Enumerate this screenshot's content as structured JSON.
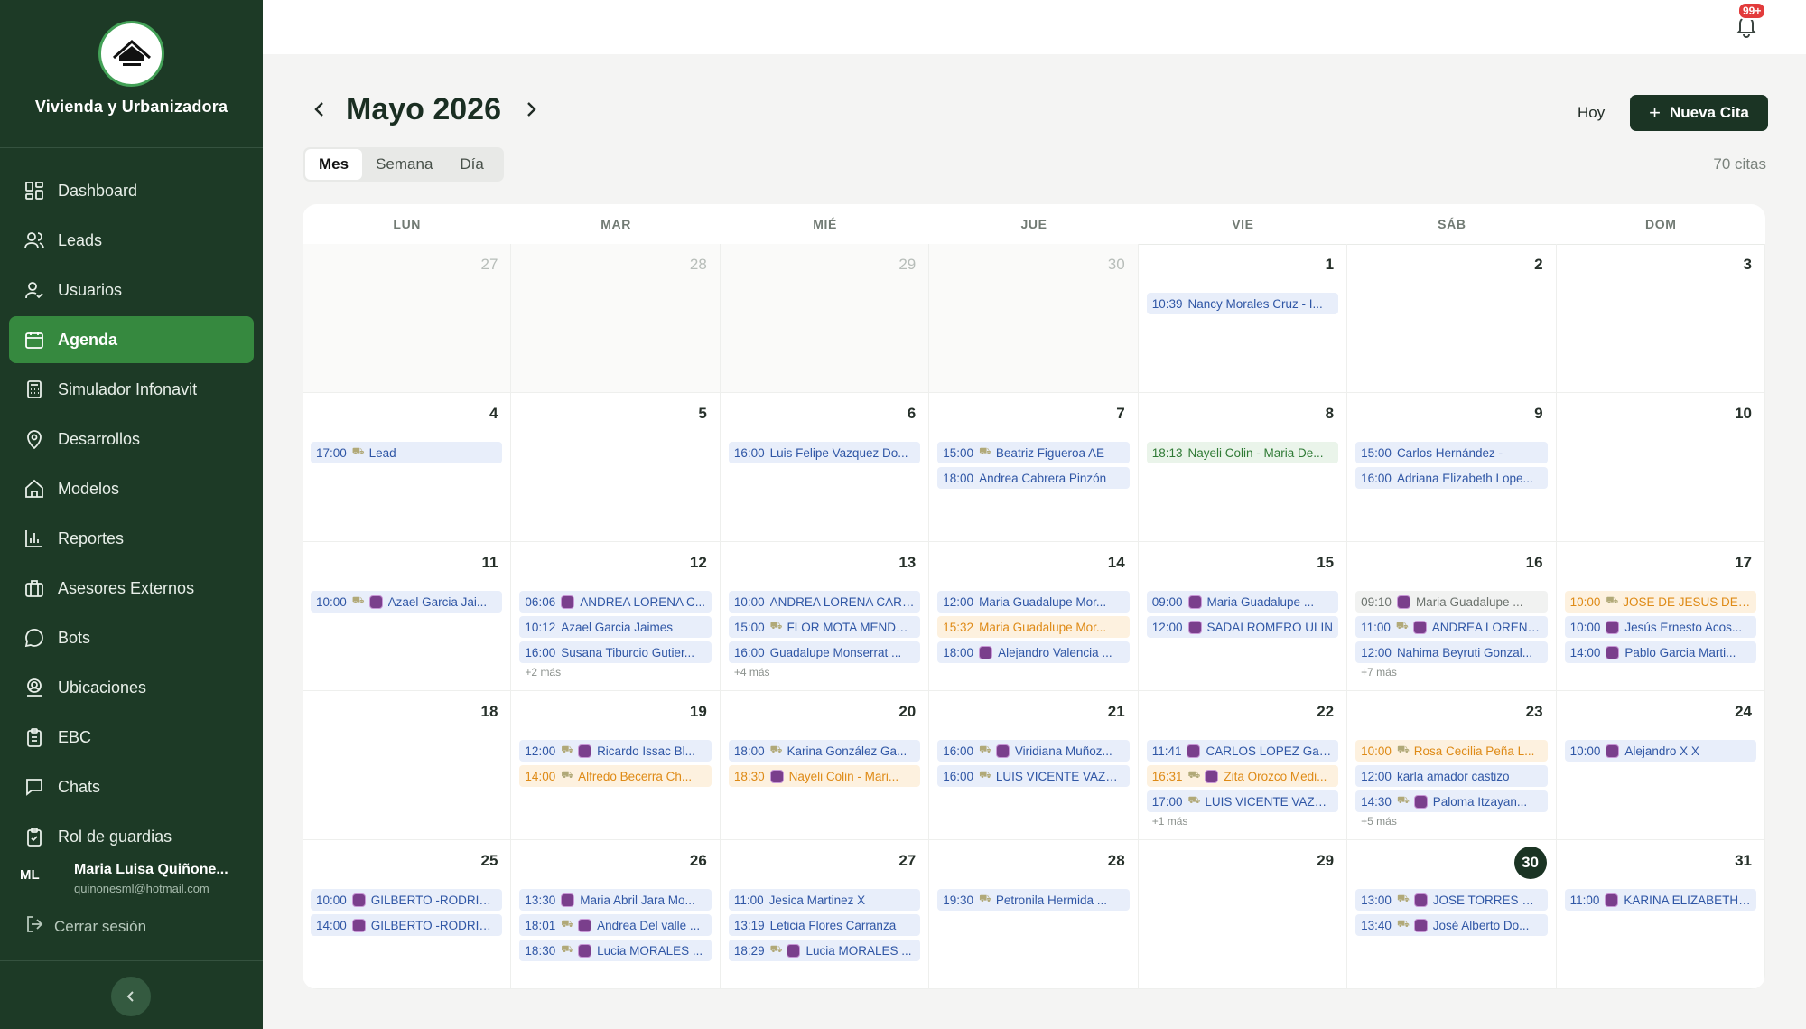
{
  "brand": {
    "name": "Vivienda y Urbanizadora"
  },
  "nav": [
    {
      "label": "Dashboard",
      "icon": "dashboard-icon",
      "active": false
    },
    {
      "label": "Leads",
      "icon": "users-icon",
      "active": false
    },
    {
      "label": "Usuarios",
      "icon": "user-check-icon",
      "active": false
    },
    {
      "label": "Agenda",
      "icon": "calendar-icon",
      "active": true
    },
    {
      "label": "Simulador Infonavit",
      "icon": "calculator-icon",
      "active": false
    },
    {
      "label": "Desarrollos",
      "icon": "map-pin-icon",
      "active": false
    },
    {
      "label": "Modelos",
      "icon": "home-icon",
      "active": false
    },
    {
      "label": "Reportes",
      "icon": "bar-chart-icon",
      "active": false
    },
    {
      "label": "Asesores Externos",
      "icon": "briefcase-icon",
      "active": false
    },
    {
      "label": "Bots",
      "icon": "chat-bubble-icon",
      "active": false
    },
    {
      "label": "Ubicaciones",
      "icon": "user-location-icon",
      "active": false
    },
    {
      "label": "EBC",
      "icon": "clipboard-icon",
      "active": false
    },
    {
      "label": "Chats",
      "icon": "message-square-icon",
      "active": false
    },
    {
      "label": "Rol de guardias",
      "icon": "clipboard-check-icon",
      "active": false
    }
  ],
  "user": {
    "initials": "ML",
    "name": "Maria Luisa Quiñone...",
    "email": "quinonesml@hotmail.com"
  },
  "logout_label": "Cerrar sesión",
  "notifications": {
    "badge": "99+"
  },
  "header": {
    "title": "Mayo 2026",
    "today_button": "Hoy",
    "new_button": "Nueva Cita",
    "count": "70 citas"
  },
  "view_tabs": [
    {
      "label": "Mes",
      "active": true
    },
    {
      "label": "Semana",
      "active": false
    },
    {
      "label": "Día",
      "active": false
    }
  ],
  "weekdays": [
    "LUN",
    "MAR",
    "MIÉ",
    "JUE",
    "VIE",
    "SÁB",
    "DOM"
  ],
  "weeks": [
    [
      {
        "day": "27",
        "other": true,
        "events": []
      },
      {
        "day": "28",
        "other": true,
        "events": []
      },
      {
        "day": "29",
        "other": true,
        "events": []
      },
      {
        "day": "30",
        "other": true,
        "events": []
      },
      {
        "day": "1",
        "events": [
          {
            "time": "10:39",
            "text": "Nancy Morales Cruz - I..."
          }
        ]
      },
      {
        "day": "2",
        "events": []
      },
      {
        "day": "3",
        "events": []
      }
    ],
    [
      {
        "day": "4",
        "events": [
          {
            "time": "17:00",
            "car": true,
            "text": "Lead"
          }
        ]
      },
      {
        "day": "5",
        "events": []
      },
      {
        "day": "6",
        "events": [
          {
            "time": "16:00",
            "text": "Luis Felipe Vazquez Do..."
          }
        ]
      },
      {
        "day": "7",
        "events": [
          {
            "time": "15:00",
            "car": true,
            "text": "Beatriz Figueroa AE"
          },
          {
            "time": "18:00",
            "text": "Andrea Cabrera Pinzón"
          }
        ]
      },
      {
        "day": "8",
        "events": [
          {
            "time": "18:13",
            "color": "green",
            "text": "Nayeli Colin - Maria De..."
          }
        ]
      },
      {
        "day": "9",
        "events": [
          {
            "time": "15:00",
            "text": "Carlos Hernández -"
          },
          {
            "time": "16:00",
            "text": "Adriana Elizabeth Lope..."
          }
        ]
      },
      {
        "day": "10",
        "events": []
      }
    ],
    [
      {
        "day": "11",
        "events": [
          {
            "time": "10:00",
            "car": true,
            "avatar": true,
            "text": "Azael Garcia Jai..."
          }
        ]
      },
      {
        "day": "12",
        "events": [
          {
            "time": "06:06",
            "avatar": true,
            "text": "ANDREA LORENA C..."
          },
          {
            "time": "10:12",
            "text": "Azael Garcia Jaimes"
          },
          {
            "time": "16:00",
            "text": "Susana Tiburcio Gutier..."
          }
        ],
        "more": "+2 más"
      },
      {
        "day": "13",
        "events": [
          {
            "time": "10:00",
            "text": "ANDREA LORENA CARR..."
          },
          {
            "time": "15:00",
            "car": true,
            "text": "FLOR MOTA MENDO..."
          },
          {
            "time": "16:00",
            "text": "Guadalupe Monserrat ..."
          }
        ],
        "more": "+4 más"
      },
      {
        "day": "14",
        "events": [
          {
            "time": "12:00",
            "text": "Maria Guadalupe Mor..."
          },
          {
            "time": "15:32",
            "color": "orange",
            "text": "Maria Guadalupe Mor..."
          },
          {
            "time": "18:00",
            "avatar": true,
            "text": "Alejandro Valencia ..."
          }
        ]
      },
      {
        "day": "15",
        "events": [
          {
            "time": "09:00",
            "avatar": true,
            "text": "Maria Guadalupe ..."
          },
          {
            "time": "12:00",
            "avatar": true,
            "text": "SADAI ROMERO ULIN"
          }
        ]
      },
      {
        "day": "16",
        "events": [
          {
            "time": "09:10",
            "color": "gray",
            "avatar": true,
            "text": "Maria Guadalupe ..."
          },
          {
            "time": "11:00",
            "avatar": true,
            "car": true,
            "text": "ANDREA LORENA ..."
          },
          {
            "time": "12:00",
            "text": "Nahima Beyruti Gonzal..."
          }
        ],
        "more": "+7 más"
      },
      {
        "day": "17",
        "events": [
          {
            "time": "10:00",
            "color": "orange",
            "car": true,
            "text": "JOSE DE JESUS DE L..."
          },
          {
            "time": "10:00",
            "avatar": true,
            "text": "Jesús Ernesto Acos..."
          },
          {
            "time": "14:00",
            "avatar": true,
            "text": "Pablo Garcia Marti..."
          }
        ]
      }
    ],
    [
      {
        "day": "18",
        "events": []
      },
      {
        "day": "19",
        "events": [
          {
            "time": "12:00",
            "car": true,
            "avatar": true,
            "text": "Ricardo Issac Bl..."
          },
          {
            "time": "14:00",
            "color": "orange",
            "car": true,
            "text": "Alfredo Becerra Ch..."
          }
        ]
      },
      {
        "day": "20",
        "events": [
          {
            "time": "18:00",
            "car": true,
            "text": "Karina González Ga..."
          },
          {
            "time": "18:30",
            "color": "orange",
            "avatar": true,
            "text": "Nayeli Colin - Mari..."
          }
        ]
      },
      {
        "day": "21",
        "events": [
          {
            "time": "16:00",
            "avatar": true,
            "car": true,
            "text": "Viridiana Muñoz..."
          },
          {
            "time": "16:00",
            "car": true,
            "text": "LUIS VICENTE VAZQ..."
          }
        ]
      },
      {
        "day": "22",
        "events": [
          {
            "time": "11:41",
            "avatar": true,
            "text": "CARLOS LOPEZ Galán"
          },
          {
            "time": "16:31",
            "color": "orange",
            "car": true,
            "avatar": true,
            "text": "Zita Orozco Medi..."
          },
          {
            "time": "17:00",
            "car": true,
            "text": "LUIS VICENTE VAZQ..."
          }
        ],
        "more": "+1 más"
      },
      {
        "day": "23",
        "events": [
          {
            "time": "10:00",
            "color": "orange",
            "car": true,
            "text": "Rosa Cecilia Peña L..."
          },
          {
            "time": "12:00",
            "text": "karla amador castizo"
          },
          {
            "time": "14:30",
            "avatar": true,
            "car": true,
            "text": "Paloma Itzayan..."
          }
        ],
        "more": "+5 más"
      },
      {
        "day": "24",
        "events": [
          {
            "time": "10:00",
            "avatar": true,
            "text": "Alejandro X X"
          }
        ]
      }
    ],
    [
      {
        "day": "25",
        "events": [
          {
            "time": "10:00",
            "avatar": true,
            "text": "GILBERTO -RODRIG..."
          },
          {
            "time": "14:00",
            "avatar": true,
            "text": "GILBERTO -RODRIG..."
          }
        ]
      },
      {
        "day": "26",
        "events": [
          {
            "time": "13:30",
            "avatar": true,
            "text": "Maria Abril Jara Mo..."
          },
          {
            "time": "18:01",
            "car": true,
            "avatar": true,
            "text": "Andrea Del valle ..."
          },
          {
            "time": "18:30",
            "avatar": true,
            "car": true,
            "text": "Lucia MORALES ..."
          }
        ]
      },
      {
        "day": "27",
        "events": [
          {
            "time": "11:00",
            "text": "Jesica Martinez X"
          },
          {
            "time": "13:19",
            "text": "Leticia Flores Carranza"
          },
          {
            "time": "18:29",
            "avatar": true,
            "car": true,
            "text": "Lucia MORALES ..."
          }
        ]
      },
      {
        "day": "28",
        "events": [
          {
            "time": "19:30",
            "car": true,
            "text": "Petronila Hermida ..."
          }
        ]
      },
      {
        "day": "29",
        "events": []
      },
      {
        "day": "30",
        "today": true,
        "events": [
          {
            "time": "13:00",
            "avatar": true,
            "car": true,
            "text": "JOSE TORRES GO..."
          },
          {
            "time": "13:40",
            "car": true,
            "avatar": true,
            "text": "José Alberto Do..."
          }
        ]
      },
      {
        "day": "31",
        "events": [
          {
            "time": "11:00",
            "avatar": true,
            "text": "KARINA ELIZABETH H..."
          }
        ]
      }
    ]
  ]
}
